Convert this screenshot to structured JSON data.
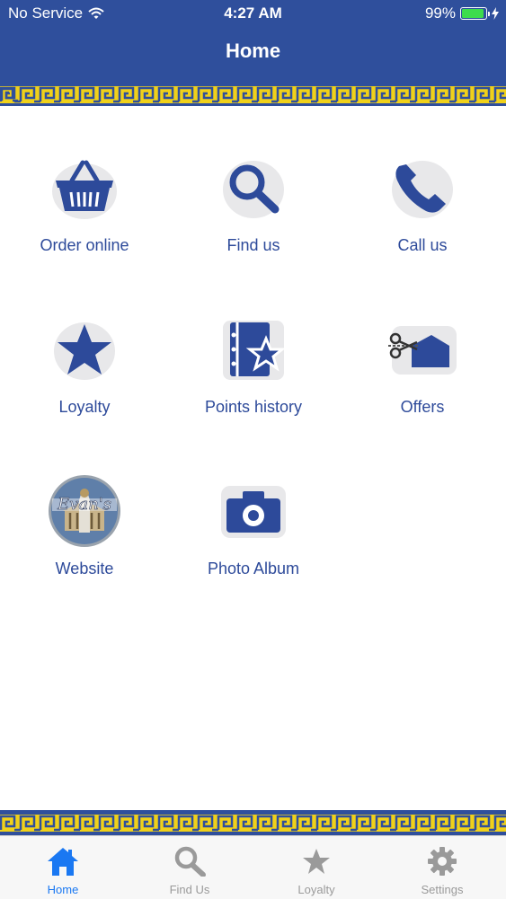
{
  "status_bar": {
    "carrier": "No Service",
    "time": "4:27 AM",
    "battery": "99%",
    "battery_level": 0.99
  },
  "nav": {
    "title": "Home"
  },
  "colors": {
    "brand": "#2f4f9c",
    "gold": "#f0d11a",
    "tab_active": "#1a78f2",
    "tab_inactive": "#9a9a9a"
  },
  "tiles": [
    {
      "label": "Order online",
      "icon": "basket-icon"
    },
    {
      "label": "Find us",
      "icon": "magnifier-icon"
    },
    {
      "label": "Call us",
      "icon": "phone-icon"
    },
    {
      "label": "Loyalty",
      "icon": "star-icon"
    },
    {
      "label": "Points history",
      "icon": "star-book-icon"
    },
    {
      "label": "Offers",
      "icon": "scissors-coupon-icon"
    },
    {
      "label": "Website",
      "icon": "evans-logo"
    },
    {
      "label": "Photo Album",
      "icon": "camera-icon"
    }
  ],
  "tabbar": {
    "active": "Home",
    "tabs": [
      {
        "label": "Home",
        "icon": "home-icon"
      },
      {
        "label": "Find Us",
        "icon": "search-icon"
      },
      {
        "label": "Loyalty",
        "icon": "star-icon"
      },
      {
        "label": "Settings",
        "icon": "gear-icon"
      }
    ]
  },
  "logo_text": "Evan's"
}
